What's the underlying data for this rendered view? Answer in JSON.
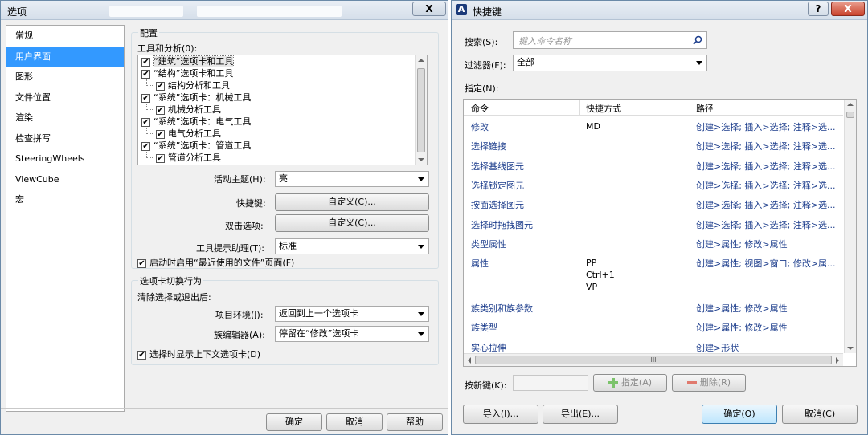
{
  "options_window": {
    "title": "选项",
    "help_glyph": "?",
    "close_glyph": "X",
    "nav": [
      "常规",
      "用户界面",
      "图形",
      "文件位置",
      "渲染",
      "检查拼写",
      "SteeringWheels",
      "ViewCube",
      "宏"
    ],
    "selected_nav": "用户界面",
    "config_group": "配置",
    "tools_label": "工具和分析(0):",
    "tree": [
      {
        "label": "“建筑”选项卡和工具",
        "indent": 0,
        "checked": true,
        "highlight": true
      },
      {
        "label": "“结构”选项卡和工具",
        "indent": 0,
        "checked": true
      },
      {
        "label": "结构分析和工具",
        "indent": 1,
        "checked": true
      },
      {
        "label": "“系统”选项卡：机械工具",
        "indent": 0,
        "checked": true
      },
      {
        "label": "机械分析工具",
        "indent": 1,
        "checked": true
      },
      {
        "label": "“系统”选项卡：电气工具",
        "indent": 0,
        "checked": true
      },
      {
        "label": "电气分析工具",
        "indent": 1,
        "checked": true
      },
      {
        "label": "“系统”选项卡：管道工具",
        "indent": 0,
        "checked": true
      },
      {
        "label": "管道分析工具",
        "indent": 1,
        "checked": true
      }
    ],
    "active_theme_label": "活动主题(H):",
    "active_theme_value": "亮",
    "shortcut_label": "快捷键:",
    "customize_button": "自定义(C)...",
    "doubleclick_label": "双击选项:",
    "customize_button2": "自定义(C)...",
    "tooltip_label": "工具提示助理(T):",
    "tooltip_value": "标准",
    "startup_checkbox": "启动时启用“最近使用的文件”页面(F)",
    "tab_switch_group": "选项卡切换行为",
    "clear_selection_label": "清除选择或退出后:",
    "project_env_label": "项目环境(J):",
    "project_env_value": "返回到上一个选项卡",
    "family_editor_label": "族编辑器(A):",
    "family_editor_value": "停留在“修改”选项卡",
    "context_tab_checkbox": "选择时显示上下文选项卡(D)",
    "ok_button": "确定",
    "cancel_button": "取消",
    "help_button": "帮助"
  },
  "shortcut_window": {
    "title": "快捷键",
    "help_glyph": "?",
    "close_glyph": "X",
    "search_label": "搜索(S):",
    "search_placeholder": "键入命令名称",
    "filter_label": "过滤器(F):",
    "filter_value": "全部",
    "assign_label": "指定(N):",
    "columns": [
      "命令",
      "快捷方式",
      "路径"
    ],
    "rows": [
      {
        "command": "修改",
        "shortcut": "MD",
        "path": "创建>选择; 插入>选择; 注释>选..."
      },
      {
        "command": "选择链接",
        "shortcut": "",
        "path": "创建>选择; 插入>选择; 注释>选..."
      },
      {
        "command": "选择基线图元",
        "shortcut": "",
        "path": "创建>选择; 插入>选择; 注释>选..."
      },
      {
        "command": "选择锁定图元",
        "shortcut": "",
        "path": "创建>选择; 插入>选择; 注释>选..."
      },
      {
        "command": "按面选择图元",
        "shortcut": "",
        "path": "创建>选择; 插入>选择; 注释>选..."
      },
      {
        "command": "选择时拖拽图元",
        "shortcut": "",
        "path": "创建>选择; 插入>选择; 注释>选..."
      },
      {
        "command": "类型属性",
        "shortcut": "",
        "path": "创建>属性; 修改>属性"
      },
      {
        "command": "属性",
        "shortcut": "PP\nCtrl+1\nVP",
        "path": "创建>属性; 视图>窗口; 修改>属..."
      },
      {
        "command": "族类别和族参数",
        "shortcut": "",
        "path": "创建>属性; 修改>属性"
      },
      {
        "command": "族类型",
        "shortcut": "",
        "path": "创建>属性; 修改>属性"
      },
      {
        "command": "实心拉伸",
        "shortcut": "",
        "path": "创建>形状"
      }
    ],
    "press_key_label": "按新键(K):",
    "assign_button": "指定(A)",
    "remove_button": "删除(R)",
    "import_button": "导入(I)...",
    "export_button": "导出(E)...",
    "ok_button": "确定(O)",
    "cancel_button": "取消(C)",
    "hscroll_glyph": "III"
  }
}
